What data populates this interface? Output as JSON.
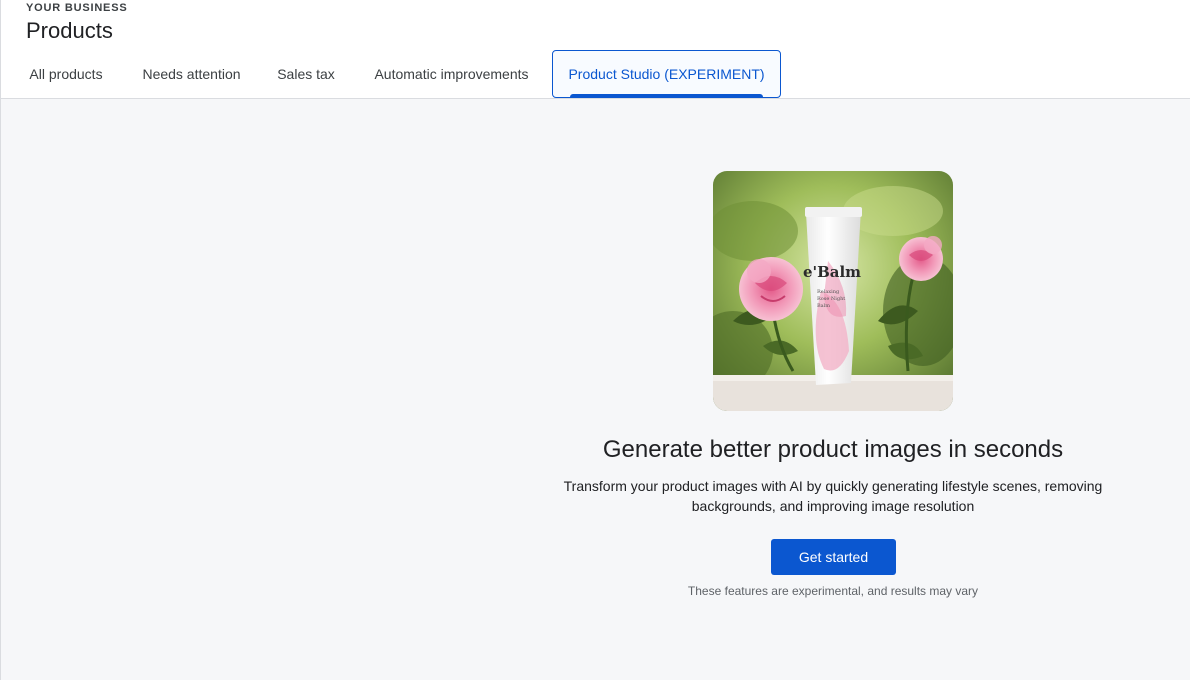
{
  "header": {
    "eyebrow": "YOUR BUSINESS",
    "title": "Products"
  },
  "tabs": [
    {
      "label": "All products",
      "active": false
    },
    {
      "label": "Needs attention",
      "active": false
    },
    {
      "label": "Sales tax",
      "active": false
    },
    {
      "label": "Automatic improvements",
      "active": false
    },
    {
      "label": "Product Studio (EXPERIMENT)",
      "active": true
    }
  ],
  "hero": {
    "product_brand": "e'Balm",
    "product_line1": "Relaxing",
    "product_line2": "Rose Night",
    "product_line3": "Balm",
    "headline": "Generate better product images in seconds",
    "description_line1": "Transform your product images with AI by quickly generating lifestyle scenes, removing",
    "description_line2": "backgrounds, and improving image resolution",
    "cta_label": "Get started",
    "disclaimer": "These features are experimental, and results may vary"
  },
  "colors": {
    "accent": "#0b57d0",
    "background": "#f6f7f9",
    "text": "#202124"
  }
}
